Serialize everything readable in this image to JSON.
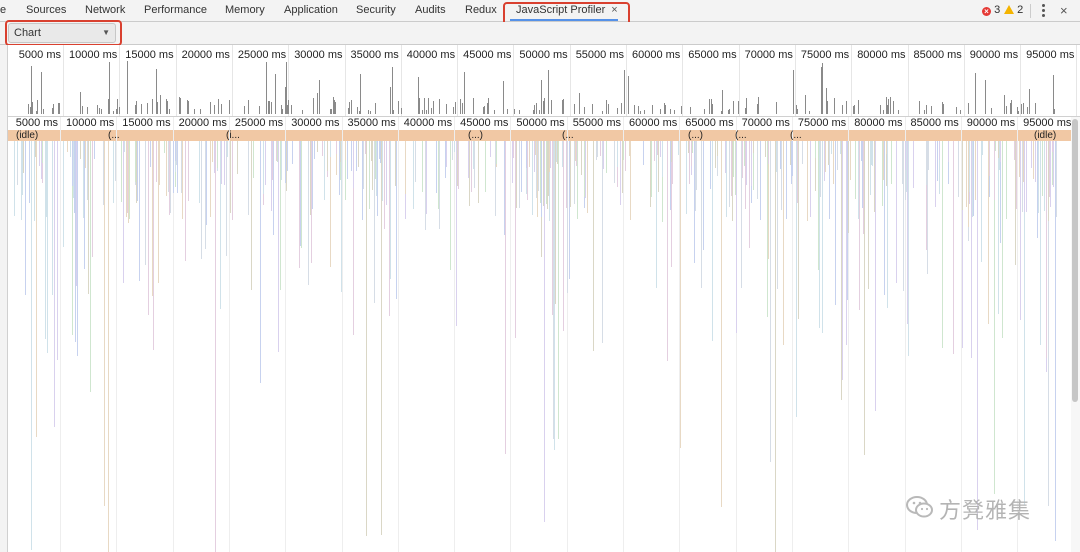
{
  "tabs": [
    {
      "label": "e"
    },
    {
      "label": "Sources"
    },
    {
      "label": "Network"
    },
    {
      "label": "Performance"
    },
    {
      "label": "Memory"
    },
    {
      "label": "Application"
    },
    {
      "label": "Security"
    },
    {
      "label": "Audits"
    },
    {
      "label": "Redux"
    },
    {
      "label": "JavaScript Profiler",
      "active": true,
      "closable": true
    }
  ],
  "tab_close_glyph": "×",
  "status": {
    "errors": "3",
    "warnings": "2"
  },
  "toolbar": {
    "view_select": {
      "value": "Chart",
      "caret": "▼"
    }
  },
  "overview": {
    "tick_labels": [
      "5000 ms",
      "10000 ms",
      "15000 ms",
      "20000 ms",
      "25000 ms",
      "30000 ms",
      "35000 ms",
      "40000 ms",
      "45000 ms",
      "50000 ms",
      "55000 ms",
      "60000 ms",
      "65000 ms",
      "70000 ms",
      "75000 ms",
      "80000 ms",
      "85000 ms",
      "90000 ms",
      "95000 ms"
    ]
  },
  "flame_chart": {
    "tick_labels": [
      "5000 ms",
      "10000 ms",
      "15000 ms",
      "20000 ms",
      "25000 ms",
      "30000 ms",
      "35000 ms",
      "40000 ms",
      "45000 ms",
      "50000 ms",
      "55000 ms",
      "60000 ms",
      "65000 ms",
      "70000 ms",
      "75000 ms",
      "80000 ms",
      "85000 ms",
      "90000 ms",
      "95000 ms"
    ],
    "top_labels": [
      "(idle)",
      "(...",
      "(i...",
      "(...)",
      "(...",
      "(...)",
      "(...",
      "(...",
      "(idle)"
    ],
    "idle_color": "#f1c8a4"
  },
  "watermark": {
    "text": "方凳雅集"
  },
  "colors": {
    "accent": "#5591e8",
    "highlight": "#d9402f",
    "error": "#e53935",
    "warning": "#f4b400"
  }
}
